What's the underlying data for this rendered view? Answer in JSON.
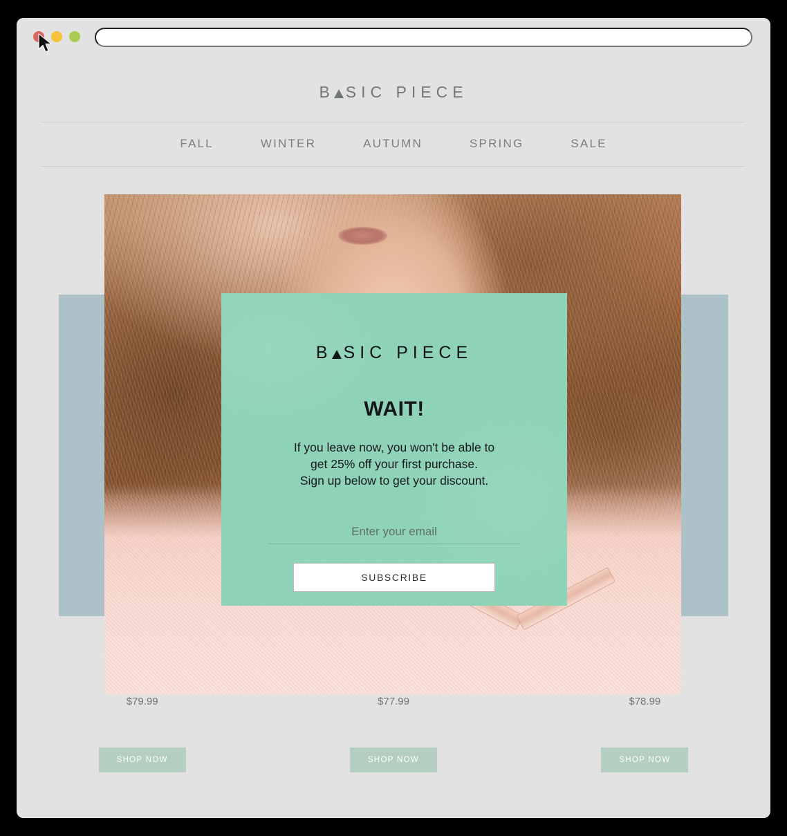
{
  "browser": {
    "traffic_lights": [
      {
        "name": "close",
        "color": "#d9675f"
      },
      {
        "name": "minimize",
        "color": "#f5c33b"
      },
      {
        "name": "maximize",
        "color": "#a8cc52"
      }
    ],
    "url_value": "",
    "url_placeholder": ""
  },
  "site": {
    "logo": {
      "before": "B",
      "after": "SIC PIECE"
    },
    "nav": [
      {
        "label": "FALL"
      },
      {
        "label": "WINTER"
      },
      {
        "label": "AUTUMN"
      },
      {
        "label": "SPRING"
      },
      {
        "label": "SALE"
      }
    ]
  },
  "modal": {
    "logo": {
      "before": "B",
      "after": "SIC PIECE"
    },
    "heading": "WAIT!",
    "body_line1": "If you leave now, you won't be able to",
    "body_line2": "get 25% off your first purchase.",
    "body_line3": "Sign up below to get your discount.",
    "email_value": "",
    "email_placeholder": "Enter your email",
    "subscribe_label": "SUBSCRIBE",
    "background_color": "#8ed3b8"
  },
  "products": [
    {
      "price": "$79.99",
      "cta": "SHOP NOW"
    },
    {
      "price": "$77.99",
      "cta": "SHOP NOW"
    },
    {
      "price": "$78.99",
      "cta": "SHOP NOW"
    }
  ],
  "colors": {
    "page_background": "#e2e2e2",
    "accent_panel": "#adc1c9",
    "shop_button": "#b4cec2",
    "mint": "#8ed3b8"
  }
}
